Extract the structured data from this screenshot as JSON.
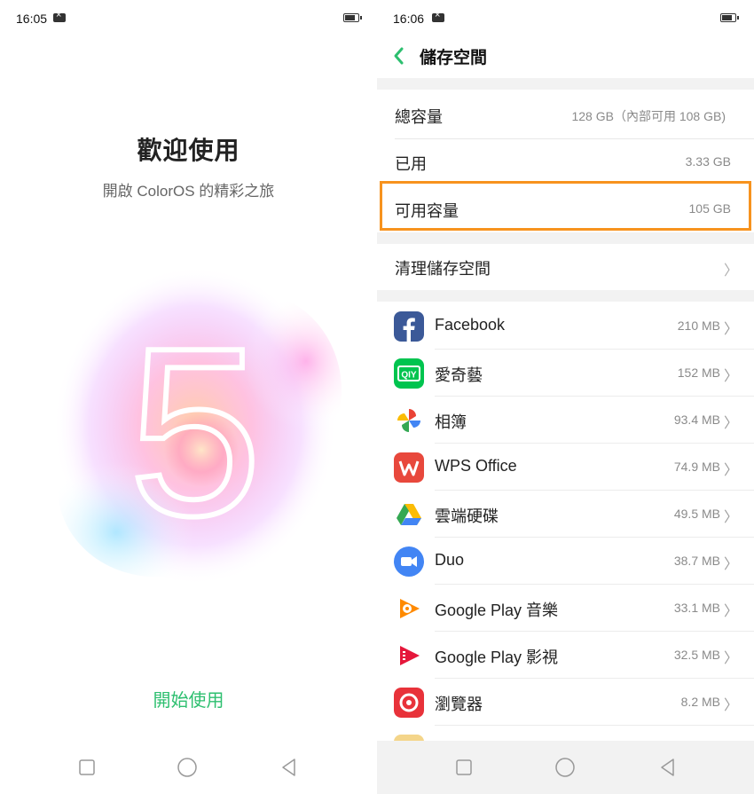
{
  "left": {
    "status": {
      "time": "16:05"
    },
    "welcome_title": "歡迎使用",
    "welcome_subtitle": "開啟 ColorOS 的精彩之旅",
    "logo_text": "5",
    "start_label": "開始使用"
  },
  "right": {
    "status": {
      "time": "16:06"
    },
    "header": {
      "title": "儲存空間"
    },
    "summary": [
      {
        "label": "總容量",
        "value": "128 GB（內部可用 108 GB)"
      },
      {
        "label": "已用",
        "value": "3.33 GB"
      },
      {
        "label": "可用容量",
        "value": "105 GB"
      }
    ],
    "clean_label": "清理儲存空間",
    "apps": [
      {
        "name": "Facebook",
        "size": "210 MB",
        "icon": "facebook-icon"
      },
      {
        "name": "愛奇藝",
        "size": "152 MB",
        "icon": "iqiyi-icon"
      },
      {
        "name": "相簿",
        "size": "93.4 MB",
        "icon": "photos-icon"
      },
      {
        "name": "WPS Office",
        "size": "74.9 MB",
        "icon": "wps-office-icon"
      },
      {
        "name": "雲端硬碟",
        "size": "49.5 MB",
        "icon": "google-drive-icon"
      },
      {
        "name": "Duo",
        "size": "38.7 MB",
        "icon": "duo-icon"
      },
      {
        "name": "Google Play 音樂",
        "size": "33.1 MB",
        "icon": "play-music-icon"
      },
      {
        "name": "Google Play 影視",
        "size": "32.5 MB",
        "icon": "play-movies-icon"
      },
      {
        "name": "瀏覽器",
        "size": "8.2 MB",
        "icon": "browser-icon"
      }
    ],
    "highlight_color": "#f7931e"
  },
  "colors": {
    "accent_green": "#2dbf6f"
  }
}
